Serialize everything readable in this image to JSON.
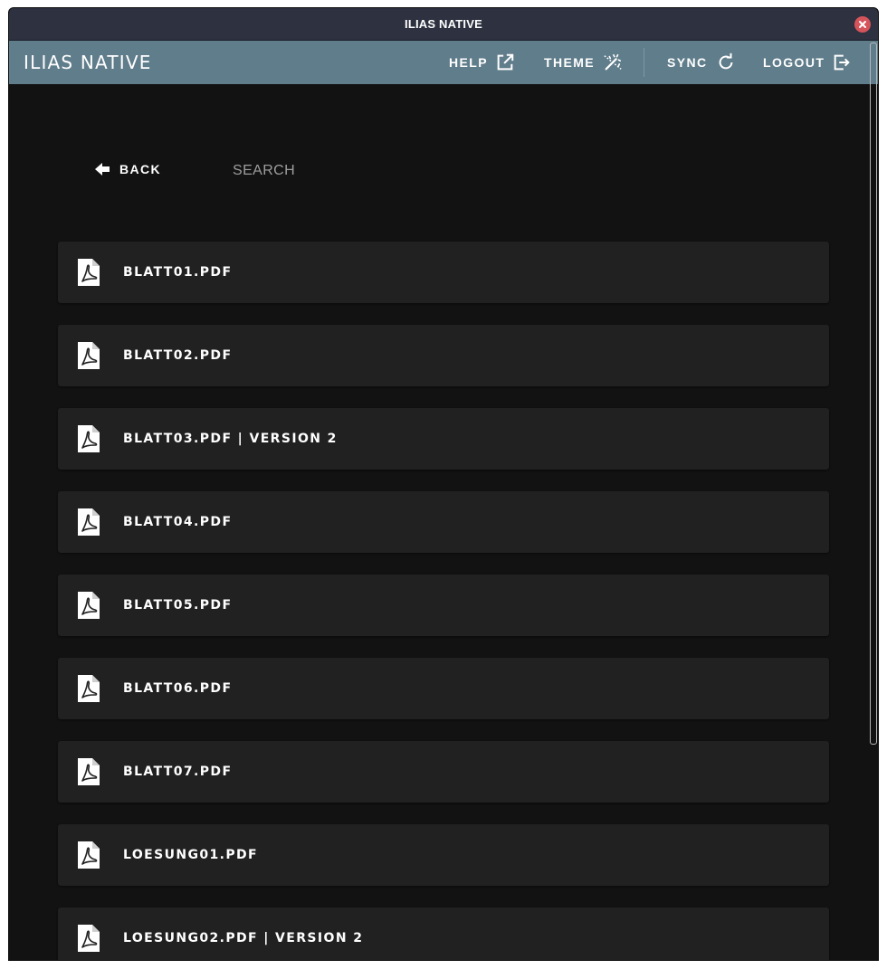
{
  "window": {
    "title": "ILIAS NATIVE"
  },
  "appbar": {
    "brand": "ILIAS NATIVE",
    "help_label": "HELP",
    "theme_label": "THEME",
    "sync_label": "SYNC",
    "logout_label": "LOGOUT"
  },
  "toolbar": {
    "back_label": "BACK",
    "search_label": "SEARCH"
  },
  "files": [
    {
      "label": "BLATT01.PDF",
      "icon": "pdf-icon"
    },
    {
      "label": "BLATT02.PDF",
      "icon": "pdf-icon"
    },
    {
      "label": "BLATT03.PDF | VERSION 2",
      "icon": "pdf-icon"
    },
    {
      "label": "BLATT04.PDF",
      "icon": "pdf-icon"
    },
    {
      "label": "BLATT05.PDF",
      "icon": "pdf-icon"
    },
    {
      "label": "BLATT06.PDF",
      "icon": "pdf-icon"
    },
    {
      "label": "BLATT07.PDF",
      "icon": "pdf-icon"
    },
    {
      "label": "LOESUNG01.PDF",
      "icon": "pdf-icon"
    },
    {
      "label": "LOESUNG02.PDF | VERSION 2",
      "icon": "pdf-icon"
    }
  ],
  "colors": {
    "titlebar": "#2d3140",
    "appbar": "#607d8b",
    "background": "#121212",
    "card": "#212121",
    "close": "#d5545b"
  }
}
